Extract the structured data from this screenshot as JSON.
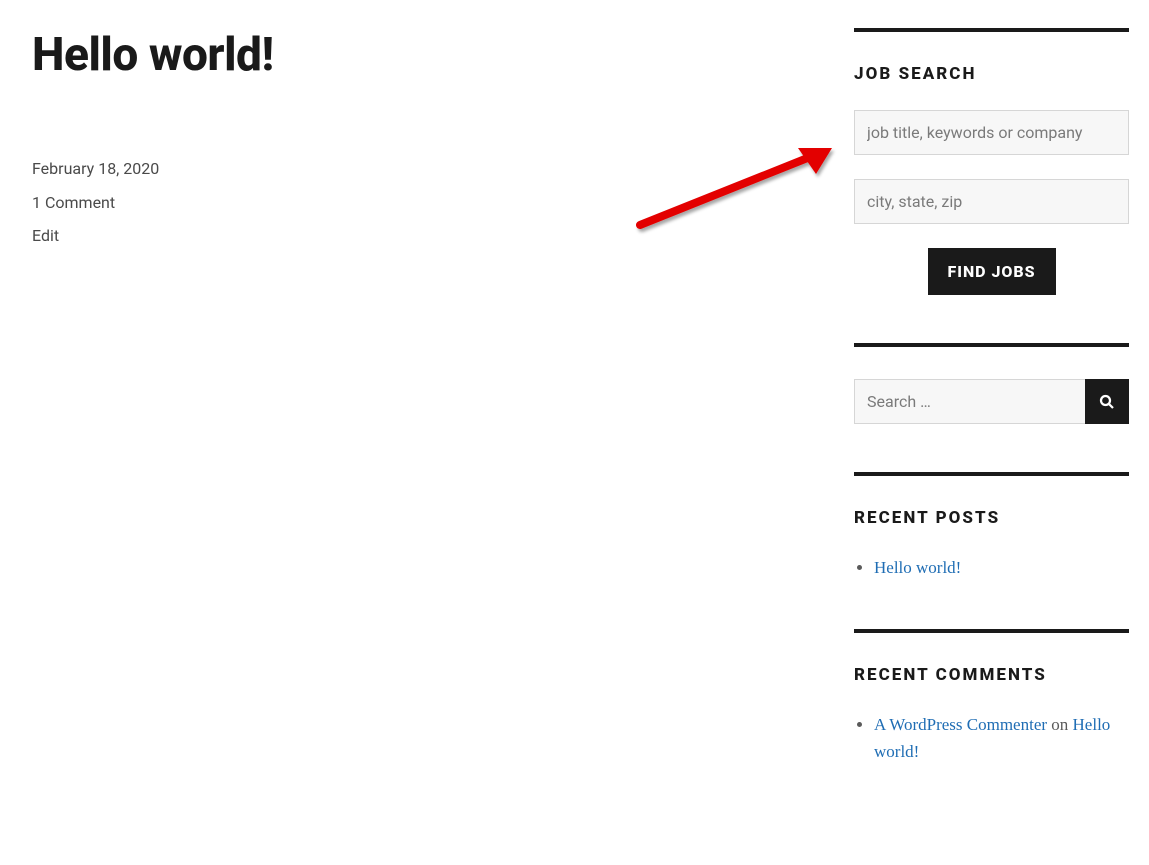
{
  "post": {
    "title": "Hello world!",
    "date": "February 18, 2020",
    "comments": "1 Comment",
    "edit": "Edit"
  },
  "sidebar": {
    "job_search": {
      "title": "JOB SEARCH",
      "keyword_placeholder": "job title, keywords or company",
      "location_placeholder": "city, state, zip",
      "button": "FIND JOBS"
    },
    "search": {
      "placeholder": "Search …"
    },
    "recent_posts": {
      "title": "RECENT POSTS",
      "items": [
        "Hello world!"
      ]
    },
    "recent_comments": {
      "title": "RECENT COMMENTS",
      "items": [
        {
          "author": "A WordPress Commenter",
          "on": " on ",
          "post": "Hello world!"
        }
      ]
    }
  }
}
